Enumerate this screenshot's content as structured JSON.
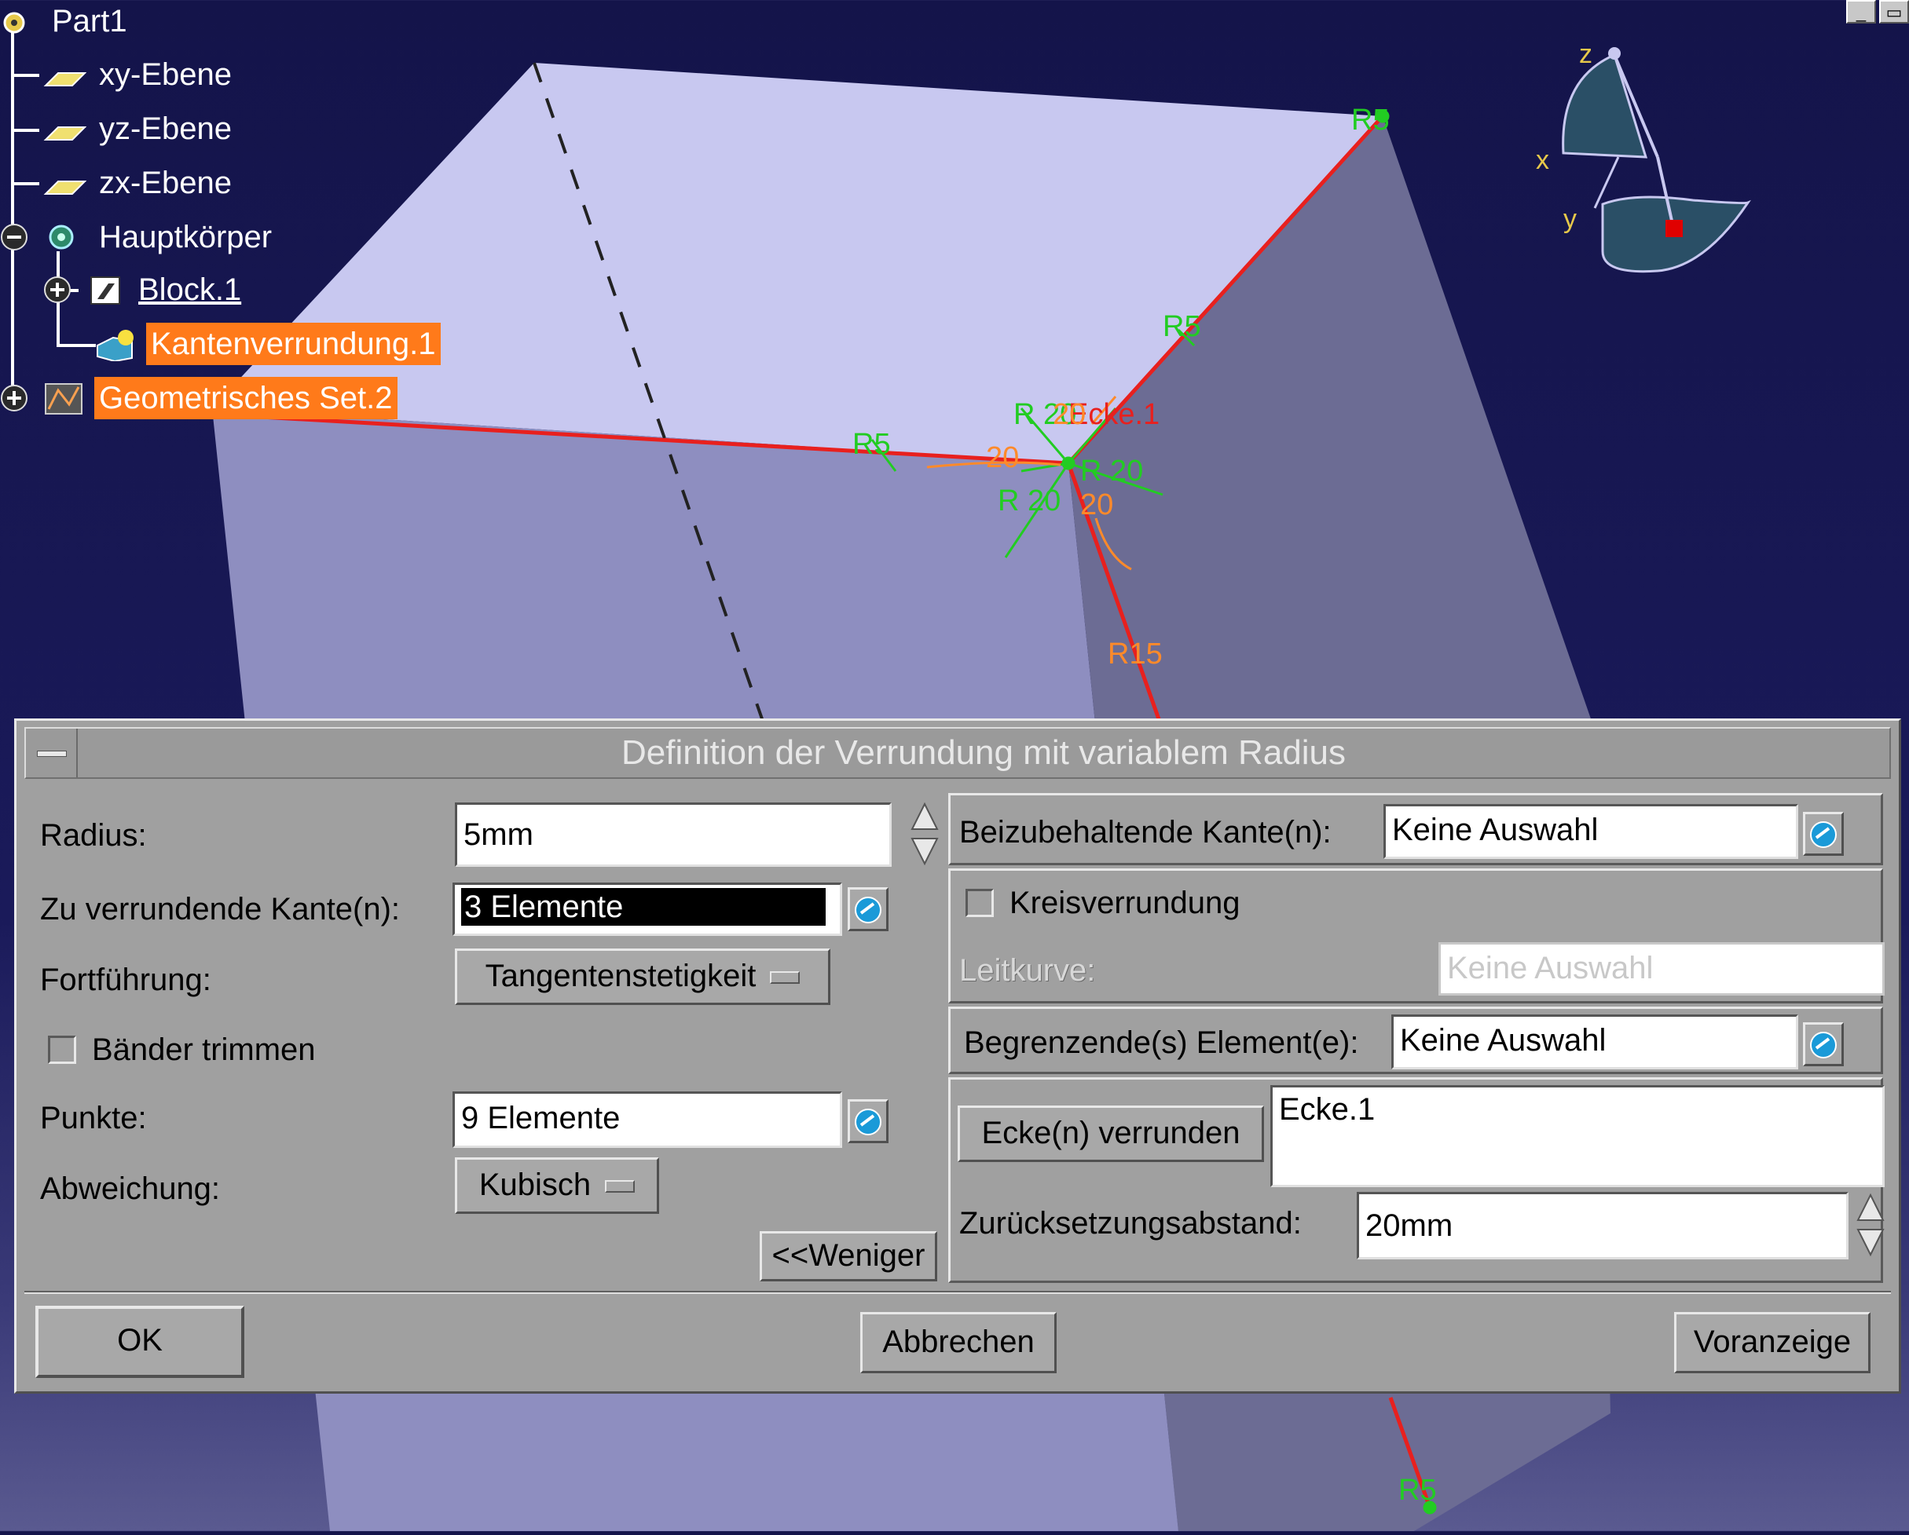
{
  "tree": {
    "root": "Part1",
    "items": [
      {
        "label": "xy-Ebene"
      },
      {
        "label": "yz-Ebene"
      },
      {
        "label": "zx-Ebene"
      },
      {
        "label": "Hauptkörper"
      },
      {
        "label": "Block.1"
      },
      {
        "label": "Kantenverrundung.1"
      },
      {
        "label": "Geometrisches Set.2"
      }
    ]
  },
  "viewport": {
    "annotations": {
      "r5_top": "R5",
      "r5_right": "R5",
      "r5_left": "R5",
      "r15": "R15",
      "r5_bottom": "R5",
      "r20_a": "R 20",
      "r20_b": "R 20",
      "r20_c": "R 20",
      "ecke": "Ecke.1",
      "num20_a": "20",
      "num20_b": "20",
      "num20_c": "20"
    },
    "compass": {
      "x": "x",
      "y": "y",
      "z": "z"
    }
  },
  "window_buttons": {
    "minimize": "_",
    "restore": "▭"
  },
  "dialog": {
    "title": "Definition der Verrundung mit variablem Radius",
    "radius_label": "Radius:",
    "radius_value": "5mm",
    "edges_label": "Zu verrundende Kante(n):",
    "edges_value": "3 Elemente",
    "propagation_label": "Fortführung:",
    "propagation_value": "Tangentenstetigkeit",
    "trim_label": "Bänder trimmen",
    "points_label": "Punkte:",
    "points_value": "9 Elemente",
    "variation_label": "Abweichung:",
    "variation_value": "Kubisch",
    "less_button": "<<Weniger",
    "keep_edges_label": "Beizubehaltende Kante(n):",
    "keep_edges_value": "Keine Auswahl",
    "circle_fillet_label": "Kreisverrundung",
    "spine_label": "Leitkurve:",
    "spine_value": "Keine Auswahl",
    "limiting_label": "Begrenzende(s) Element(e):",
    "limiting_value": "Keine Auswahl",
    "vertex_button": "Ecke(n) verrunden",
    "vertex_value": "Ecke.1",
    "setback_label": "Zurücksetzungsabstand:",
    "setback_value": "20mm",
    "ok": "OK",
    "cancel": "Abbrechen",
    "preview": "Voranzeige"
  },
  "colors": {
    "background": "#14144a",
    "highlight": "#ff7a1a",
    "edge_selected": "#e8201e",
    "annotation_green": "#22cc22",
    "annotation_orange": "#ff8a2a",
    "dialog_gray": "#a0a0a0"
  }
}
